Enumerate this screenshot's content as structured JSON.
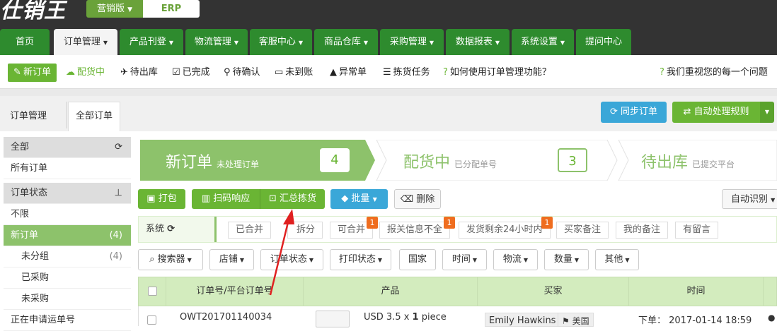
{
  "brand": {
    "logo": "仕销王",
    "edition": "营销版",
    "edition_caret": "▼",
    "erp": "ERP"
  },
  "nav": [
    "首页",
    "订单管理",
    "产品刊登",
    "物流管理",
    "客服中心",
    "商品仓库",
    "采购管理",
    "数据报表",
    "系统设置",
    "提问中心"
  ],
  "nav_caret": "▼",
  "subnav": {
    "new_order": "新订单",
    "allocating": "配货中",
    "to_ship": "待出库",
    "done": "已完成",
    "to_confirm": "待确认",
    "unpaid": "未到账",
    "abnormal": "异常单",
    "picking": "拣货任务",
    "help": "如何使用订单管理功能？",
    "feedback": "我们重视您的每一个问题"
  },
  "breadcrumb": {
    "parent": "订单管理",
    "current": "全部订单"
  },
  "actions": {
    "sync": "同步订单",
    "auto_rule": "自动处理规则",
    "caret": "▼"
  },
  "sidebar": {
    "all": "全部",
    "all_orders": "所有订单",
    "status_header": "订单状态",
    "unlimited": "不限",
    "new_order": "新订单",
    "new_count": "(4)",
    "ungrouped": "未分组",
    "ungrouped_count": "(4)",
    "purchased": "已采购",
    "not_purchased": "未采购",
    "applying": "正在申请运单号"
  },
  "steps": [
    {
      "title": "新订单",
      "sub": "未处理订单",
      "count": "4"
    },
    {
      "title": "配货中",
      "sub": "已分配单号",
      "count": "3"
    },
    {
      "title": "待出库",
      "sub": "已提交平台"
    }
  ],
  "toolbar": {
    "pack": "打包",
    "scan": "扫码响应",
    "summary": "汇总拣货",
    "batch": "批量",
    "delete": "删除",
    "auto_identify": "自动识别"
  },
  "filters": {
    "system": "系统",
    "merged": "已合并",
    "split": "拆分",
    "mergeable": "可合并",
    "customs_missing": "报关信息不全",
    "ship_24h": "发货剩余24小时内",
    "buyer_note": "买家备注",
    "my_note": "我的备注",
    "has_message": "有留言",
    "badge": "1"
  },
  "search_row": {
    "searcher": "搜索器",
    "shop": "店铺",
    "order_status": "订单状态",
    "print_status": "打印状态",
    "country": "国家",
    "time": "时间",
    "logistics": "物流",
    "quantity": "数量",
    "other": "其他",
    "caret": "▼"
  },
  "table": {
    "headers": [
      "订单号/平台订单号",
      "产品",
      "买家",
      "时间"
    ],
    "row": {
      "order_no": "OWT201701140034",
      "product": "USD 3.5 x ",
      "qty": "1",
      "unit": " piece",
      "buyer": "Emily Hawkins",
      "country": "美国",
      "order_time": "下单：  2017-01-14 18:59"
    }
  },
  "colors": {
    "green": "#6ab534",
    "dark": "#333333",
    "tab_green": "#2e8b2e",
    "blue": "#3aa7d8",
    "orange": "#ef6d1f",
    "header_green": "#d3ecbe",
    "arrow": "#e02020"
  }
}
